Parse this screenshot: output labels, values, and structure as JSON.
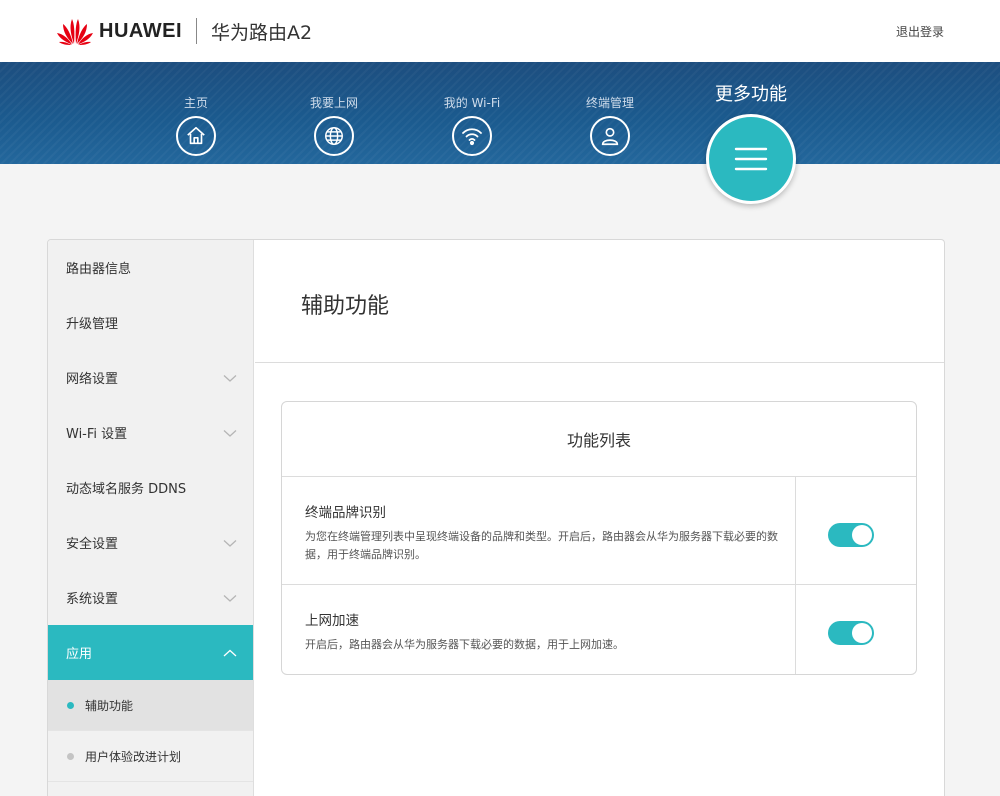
{
  "header": {
    "brand": "HUAWEI",
    "model": "华为路由A2",
    "logout_label": "退出登录"
  },
  "nav": {
    "items": [
      {
        "label": "主页",
        "icon": "home-icon"
      },
      {
        "label": "我要上网",
        "icon": "globe-icon"
      },
      {
        "label": "我的 Wi-Fi",
        "icon": "wifi-icon"
      },
      {
        "label": "终端管理",
        "icon": "user-icon"
      }
    ],
    "active": {
      "label": "更多功能",
      "icon": "menu-icon"
    }
  },
  "sidebar": {
    "items": [
      {
        "label": "路由器信息",
        "expandable": false
      },
      {
        "label": "升级管理",
        "expandable": false
      },
      {
        "label": "网络设置",
        "expandable": true
      },
      {
        "label": "Wi-Fi 设置",
        "expandable": true
      },
      {
        "label": "动态域名服务 DDNS",
        "expandable": false
      },
      {
        "label": "安全设置",
        "expandable": true
      },
      {
        "label": "系统设置",
        "expandable": true
      },
      {
        "label": "应用",
        "expandable": true,
        "expanded": true
      }
    ],
    "sub_items": [
      {
        "label": "辅助功能",
        "selected": true
      },
      {
        "label": "用户体验改进计划",
        "selected": false
      }
    ]
  },
  "content": {
    "title": "辅助功能",
    "list_title": "功能列表",
    "features": [
      {
        "title": "终端品牌识别",
        "description": "为您在终端管理列表中呈现终端设备的品牌和类型。开启后，路由器会从华为服务器下载必要的数据，用于终端品牌识别。",
        "enabled": true
      },
      {
        "title": "上网加速",
        "description": "开启后，路由器会从华为服务器下载必要的数据，用于上网加速。",
        "enabled": true
      }
    ]
  },
  "colors": {
    "accent": "#2bb9c0",
    "nav_band": "#1b5a8e"
  }
}
